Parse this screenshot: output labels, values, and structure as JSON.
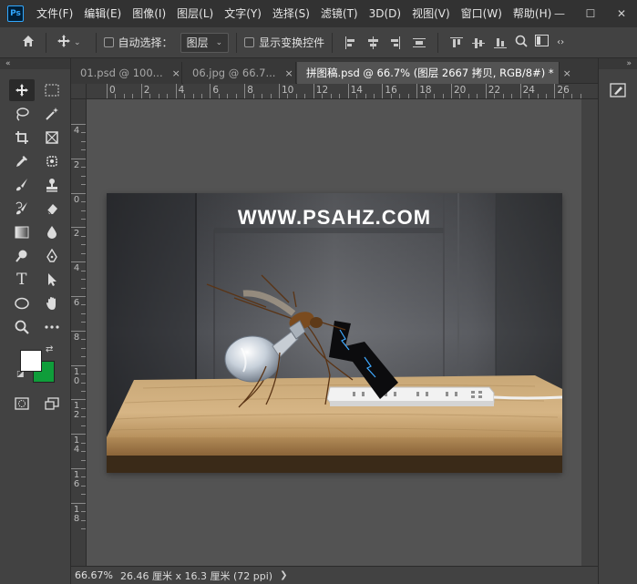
{
  "app": {
    "logo_text": "Ps",
    "menu": [
      "文件(F)",
      "编辑(E)",
      "图像(I)",
      "图层(L)",
      "文字(Y)",
      "选择(S)",
      "滤镜(T)",
      "3D(D)",
      "视图(V)",
      "窗口(W)",
      "帮助(H)"
    ]
  },
  "window_controls": {
    "minimize": "—",
    "maximize": "☐",
    "close": "✕"
  },
  "options_bar": {
    "auto_select_label": "自动选择：",
    "auto_select_checked": false,
    "auto_select_target": "图层",
    "show_transform_label": "显示变换控件",
    "show_transform_checked": false
  },
  "tabs": [
    {
      "label": "01.psd @ 100...",
      "active": false,
      "close": "×"
    },
    {
      "label": "06.jpg @ 66.7...",
      "active": false,
      "close": "×"
    },
    {
      "label": "拼图稿.psd @ 66.7% (图层 2667 拷贝, RGB/8#) *",
      "active": true,
      "close": "×"
    }
  ],
  "ruler": {
    "horizontal_labels": [
      "0",
      "2",
      "4",
      "6",
      "8",
      "10",
      "12",
      "14",
      "16",
      "18",
      "20",
      "22",
      "24",
      "26"
    ],
    "vertical_labels": [
      "4",
      "2",
      "0",
      "2",
      "4",
      "6",
      "8",
      "10",
      "12",
      "14",
      "16",
      "18"
    ]
  },
  "artwork": {
    "watermark": "WWW.PSAHZ.COM"
  },
  "colors": {
    "foreground": "#ffffff",
    "background": "#0f9d3a",
    "ps_accent": "#31a8ff"
  },
  "status": {
    "zoom": "66.67%",
    "doc_size": "26.46 厘米 x 16.3 厘米 (72 ppi)",
    "arrow": "❯"
  },
  "toolbar_icons": [
    [
      "move-icon",
      "rect-marquee-icon"
    ],
    [
      "lasso-icon",
      "magic-wand-icon"
    ],
    [
      "crop-icon",
      "frame-icon"
    ],
    [
      "eyedropper-icon",
      "spot-heal-icon"
    ],
    [
      "brush-icon",
      "clone-stamp-icon"
    ],
    [
      "history-brush-icon",
      "eraser-icon"
    ],
    [
      "gradient-icon",
      "blur-icon"
    ],
    [
      "dodge-icon",
      "pen-icon"
    ],
    [
      "type-icon",
      "path-select-icon"
    ],
    [
      "ellipse-icon",
      "hand-icon"
    ],
    [
      "zoom-icon",
      "more-tools-icon"
    ]
  ]
}
